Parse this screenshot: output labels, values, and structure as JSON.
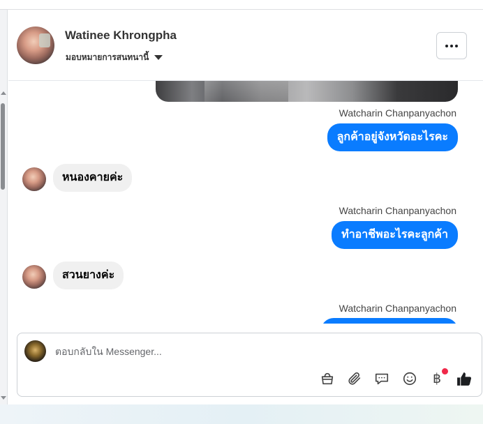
{
  "contact": {
    "name": "Watinee Khrongpha",
    "assign_label": "มอบหมายการสนทนานี้"
  },
  "thread": {
    "messages": [
      {
        "type": "image",
        "direction": "outgoing"
      },
      {
        "sender": "Watcharin Chanpanyachon",
        "direction": "outgoing",
        "text": "ลูกค้าอยู่จังหวัดอะไรคะ"
      },
      {
        "direction": "incoming",
        "text": "หนองคายค่ะ"
      },
      {
        "sender": "Watcharin Chanpanyachon",
        "direction": "outgoing",
        "text": "ทำอาชีพอะไรคะลูกค้า"
      },
      {
        "direction": "incoming",
        "text": "สวนยางค่ะ"
      },
      {
        "sender": "Watcharin Chanpanyachon",
        "direction": "outgoing",
        "text": ""
      }
    ]
  },
  "composer": {
    "placeholder": "ตอบกลับใน Messenger..."
  },
  "colors": {
    "outgoing_bubble": "#0a7cff",
    "incoming_bubble": "#f0f0f0",
    "like_icon": "#1c1e21",
    "notification_dot": "#f02849"
  },
  "icons": [
    "more-dots-icon",
    "shopping-bag-icon",
    "paperclip-icon",
    "chat-bubble-icon",
    "smiley-icon",
    "baht-icon",
    "thumbs-up-icon",
    "chevron-down-icon"
  ],
  "toolbar": {
    "baht_symbol": "฿"
  }
}
